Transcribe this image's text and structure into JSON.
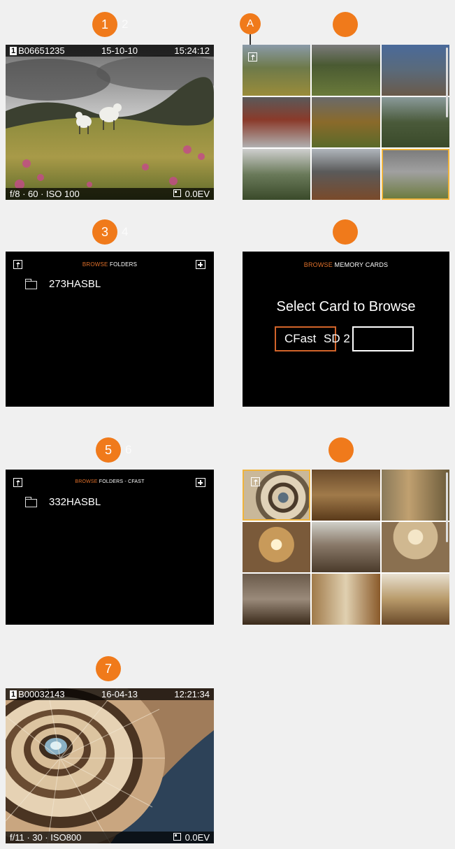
{
  "badges": {
    "b1": "1",
    "b1_ghost": "2",
    "b3": "3",
    "b3_ghost": "4",
    "b5": "5",
    "b5_ghost": "6",
    "b7": "7",
    "callout_a": "A"
  },
  "colors": {
    "accent": "#f07a1b",
    "selection": "#f0b43c",
    "screen": "#000000"
  },
  "screen1": {
    "top_bar": {
      "card": "1",
      "file": "B06651235",
      "date": "15-10-10",
      "time": "15:24:12"
    },
    "bottom_bar": {
      "exposure": "f/8 · 60 · ISO 100",
      "ev": "0.0EV"
    }
  },
  "screen2": {
    "icons": [
      "up-icon"
    ],
    "selected_tile": 8
  },
  "screen3": {
    "header_accent": "BROWSE",
    "header_rest": " FOLDERS",
    "folders": [
      "273HASBL"
    ]
  },
  "screen4": {
    "header_accent": "BROWSE",
    "header_rest": " MEMORY CARDS",
    "title": "Select Card to Browse",
    "cards": [
      "CFast",
      "SD 2"
    ]
  },
  "screen5": {
    "header_accent": "BROWSE",
    "header_rest": " FOLDERS - CFAST",
    "folders": [
      "332HASBL"
    ]
  },
  "screen6": {
    "selected_tile": 0
  },
  "screen7": {
    "top_bar": {
      "card": "1",
      "file": "B00032143",
      "date": "16-04-13",
      "time": "12:21:34"
    },
    "bottom_bar": {
      "exposure": "f/11 · 30 · ISO800",
      "ev": "0.0EV"
    }
  }
}
